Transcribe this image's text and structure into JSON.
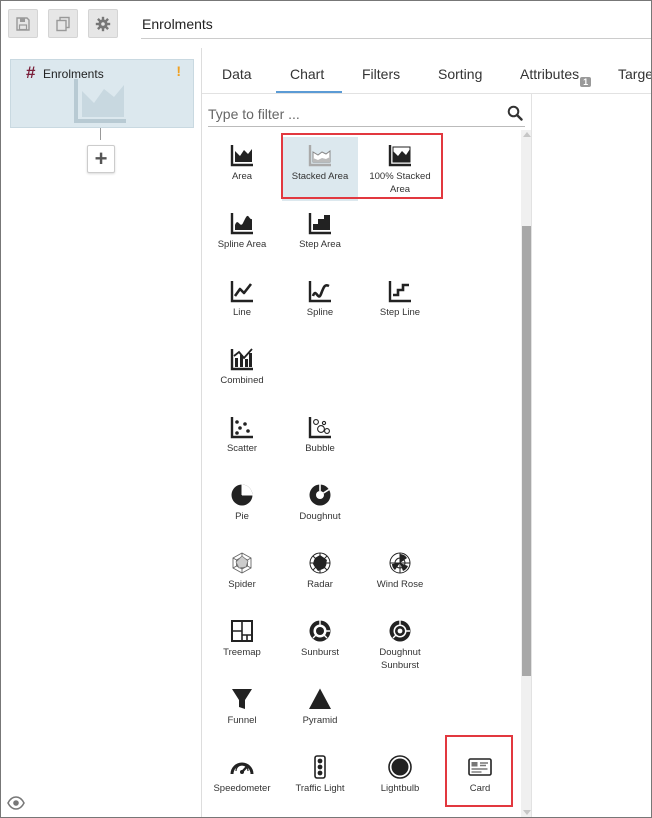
{
  "toolbar": {
    "title": "Enrolments",
    "buttons": [
      {
        "icon": "save-icon"
      },
      {
        "icon": "copy-icon"
      },
      {
        "icon": "gear-icon"
      }
    ]
  },
  "flow": {
    "node": {
      "label": "Enrolments",
      "prefix": "#",
      "warning": "!"
    },
    "add_label": "+"
  },
  "tabs": [
    {
      "label": "Data",
      "active": false
    },
    {
      "label": "Chart",
      "active": true
    },
    {
      "label": "Filters",
      "active": false
    },
    {
      "label": "Sorting",
      "active": false
    },
    {
      "label": "Attributes",
      "badge": "1",
      "active": false
    },
    {
      "label": "Targe",
      "active": false
    }
  ],
  "picker": {
    "filter_placeholder": "Type to filter ...",
    "charts": [
      {
        "id": "area",
        "label": "Area",
        "icon": "area-chart-icon",
        "selected": false
      },
      {
        "id": "stacked-area",
        "label": "Stacked Area",
        "icon": "stacked-area-chart-icon",
        "selected": true
      },
      {
        "id": "stacked-area-100",
        "label": "100% Stacked Area",
        "icon": "stacked-area-100-chart-icon",
        "selected": false
      },
      {
        "id": "spline-area",
        "label": "Spline Area",
        "icon": "spline-area-chart-icon",
        "selected": false
      },
      {
        "id": "step-area",
        "label": "Step Area",
        "icon": "step-area-chart-icon",
        "selected": false
      },
      {
        "id": "line",
        "label": "Line",
        "icon": "line-chart-icon",
        "selected": false
      },
      {
        "id": "spline",
        "label": "Spline",
        "icon": "spline-chart-icon",
        "selected": false
      },
      {
        "id": "step-line",
        "label": "Step Line",
        "icon": "step-line-chart-icon",
        "selected": false
      },
      {
        "id": "combined",
        "label": "Combined",
        "icon": "combined-chart-icon",
        "selected": false
      },
      {
        "id": "scatter",
        "label": "Scatter",
        "icon": "scatter-chart-icon",
        "selected": false
      },
      {
        "id": "bubble",
        "label": "Bubble",
        "icon": "bubble-chart-icon",
        "selected": false
      },
      {
        "id": "pie",
        "label": "Pie",
        "icon": "pie-chart-icon",
        "selected": false
      },
      {
        "id": "doughnut",
        "label": "Doughnut",
        "icon": "doughnut-chart-icon",
        "selected": false
      },
      {
        "id": "spider",
        "label": "Spider",
        "icon": "spider-chart-icon",
        "selected": false
      },
      {
        "id": "radar",
        "label": "Radar",
        "icon": "radar-chart-icon",
        "selected": false
      },
      {
        "id": "wind-rose",
        "label": "Wind Rose",
        "icon": "wind-rose-chart-icon",
        "selected": false
      },
      {
        "id": "treemap",
        "label": "Treemap",
        "icon": "treemap-chart-icon",
        "selected": false
      },
      {
        "id": "sunburst",
        "label": "Sunburst",
        "icon": "sunburst-chart-icon",
        "selected": false
      },
      {
        "id": "doughnut-sunburst",
        "label": "Doughnut Sunburst",
        "icon": "doughnut-sunburst-chart-icon",
        "selected": false
      },
      {
        "id": "funnel",
        "label": "Funnel",
        "icon": "funnel-chart-icon",
        "selected": false
      },
      {
        "id": "pyramid",
        "label": "Pyramid",
        "icon": "pyramid-chart-icon",
        "selected": false
      },
      {
        "id": "speedometer",
        "label": "Speedometer",
        "icon": "speedometer-chart-icon",
        "selected": false
      },
      {
        "id": "traffic-light",
        "label": "Traffic Light",
        "icon": "traffic-light-chart-icon",
        "selected": false
      },
      {
        "id": "lightbulb",
        "label": "Lightbulb",
        "icon": "lightbulb-chart-icon",
        "selected": false
      },
      {
        "id": "card",
        "label": "Card",
        "icon": "card-chart-icon",
        "selected": false
      }
    ]
  },
  "colors": {
    "selected_bg": "#dce8ee",
    "highlight": "#e2383f",
    "tab_underline": "#5b9bd5",
    "warning": "#f0a020",
    "hash": "#7a1f3a"
  }
}
